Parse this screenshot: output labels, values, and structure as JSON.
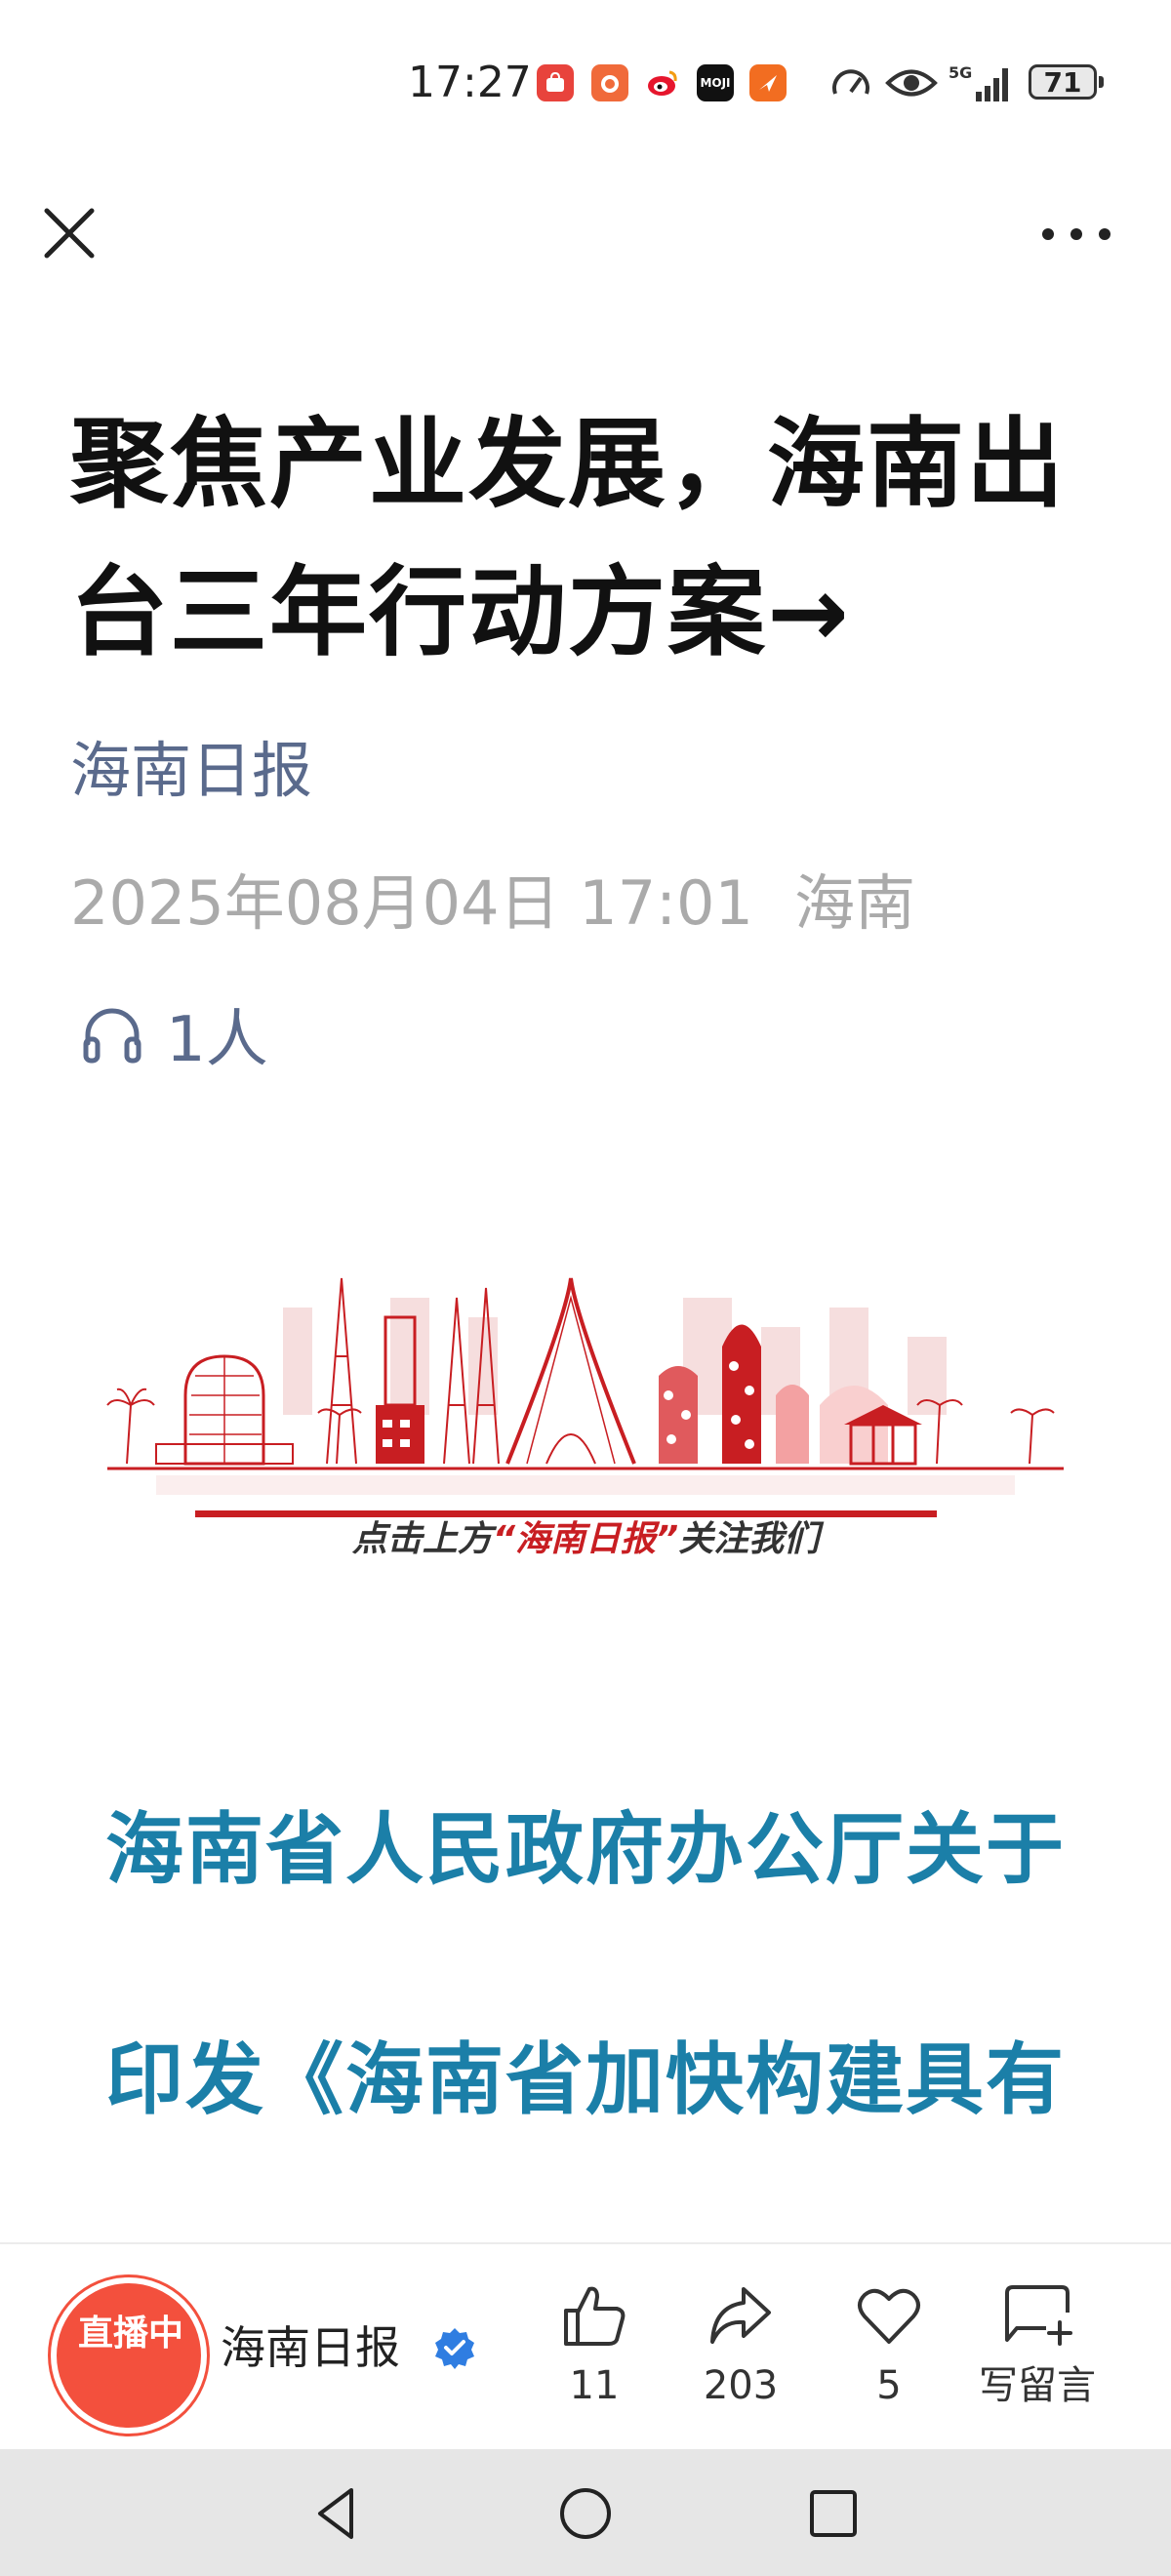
{
  "status_bar": {
    "time": "17:27",
    "app_icons": [
      "huawei-store-icon",
      "app-icon",
      "weibo-icon",
      "moji-weather-icon",
      "app-icon"
    ],
    "moji_label": "MOJI",
    "network": "5G",
    "battery": "71"
  },
  "article": {
    "title": "聚焦产业发展，海南出台三年行动方案→",
    "source": "海南日报",
    "date": "2025年08月04日 17:01",
    "location": "海南",
    "listen_count": "1人"
  },
  "banner": {
    "caption_prefix": "点击上方",
    "caption_highlight": "“海南日报”",
    "caption_suffix": "关注我们"
  },
  "body": {
    "heading_1": "海南省人民政府办公厅关于",
    "heading_2": "印发《海南省加快构建具有"
  },
  "action_bar": {
    "avatar_label": "直播中",
    "account_name": "海南日报",
    "likes": "11",
    "shares": "203",
    "favorites": "5",
    "comment_label": "写留言"
  },
  "colors": {
    "accent_blue": "#1b7fa8",
    "source_blue": "#5a6a8c",
    "live_red": "#f3503d",
    "banner_red": "#c81e22"
  }
}
